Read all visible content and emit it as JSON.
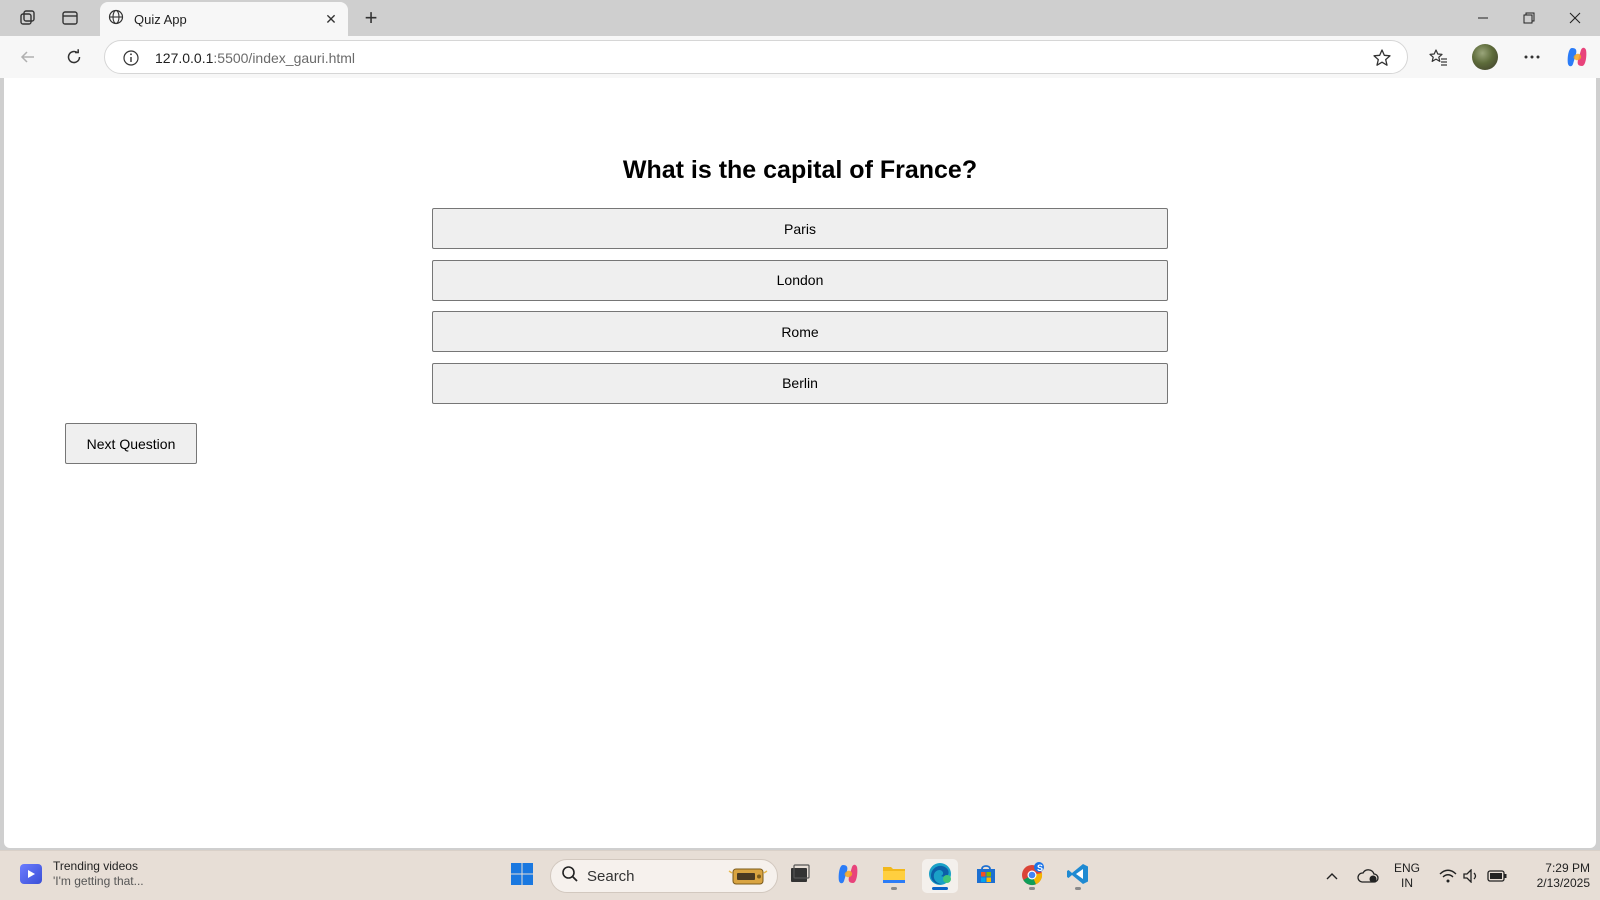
{
  "browser": {
    "tab": {
      "title": "Quiz App"
    },
    "address": {
      "host": "127.0.0.1",
      "path": ":5500/index_gauri.html"
    }
  },
  "quiz": {
    "question": "What is the capital of France?",
    "options": [
      "Paris",
      "London",
      "Rome",
      "Berlin"
    ],
    "next_label": "Next Question"
  },
  "taskbar": {
    "widget": {
      "title": "Trending videos",
      "subtitle": "'I'm getting that..."
    },
    "search_label": "Search",
    "lang": {
      "line1": "ENG",
      "line2": "IN"
    },
    "clock": {
      "time": "7:29 PM",
      "date": "2/13/2025"
    },
    "chrome_badge": "S"
  }
}
